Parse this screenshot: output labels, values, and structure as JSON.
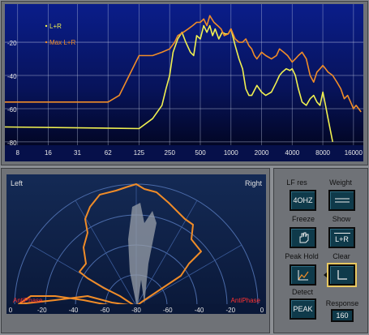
{
  "spectrum": {
    "y_ticks": [
      "-20",
      "-40",
      "-60",
      "-80"
    ],
    "x_ticks": [
      "8",
      "16",
      "31",
      "62",
      "125",
      "250",
      "500",
      "1000",
      "2000",
      "4000",
      "8000",
      "16000"
    ],
    "legend": [
      {
        "label": "L+R",
        "color": "#f0f050"
      },
      {
        "label": "Max L+R",
        "color": "#f08c28"
      }
    ],
    "chart_data": {
      "type": "line",
      "xlim": [
        6,
        20000
      ],
      "ylim": [
        -82,
        3
      ],
      "y_scale_top": 0,
      "series": [
        {
          "name": "L+R",
          "color": "#f0f050",
          "x": [
            6,
            125,
            170,
            210,
            230,
            250,
            270,
            300,
            330,
            360,
            400,
            430,
            460,
            500,
            540,
            580,
            620,
            660,
            700,
            760,
            820,
            880,
            940,
            1000,
            1100,
            1200,
            1300,
            1400,
            1500,
            1600,
            1800,
            2000,
            2200,
            2500,
            2800,
            3000,
            3200,
            3500,
            3800,
            4000,
            4300,
            4600,
            5000,
            5500,
            6000,
            6500,
            7000,
            7500,
            8000,
            8500,
            9000,
            10000
          ],
          "y": [
            -71,
            -72,
            -66,
            -58,
            -48,
            -40,
            -26,
            -18,
            -14,
            -20,
            -26,
            -28,
            -16,
            -18,
            -10,
            -14,
            -10,
            -16,
            -12,
            -18,
            -14,
            -15,
            -15,
            -12,
            -22,
            -30,
            -36,
            -48,
            -52,
            -52,
            -46,
            -50,
            -52,
            -50,
            -44,
            -40,
            -38,
            -36,
            -37,
            -36,
            -40,
            -48,
            -56,
            -58,
            -54,
            -52,
            -56,
            -58,
            -50,
            -58,
            -66,
            -80
          ]
        },
        {
          "name": "Max L+R",
          "color": "#f08c28",
          "x": [
            6,
            62,
            80,
            100,
            125,
            170,
            210,
            250,
            280,
            300,
            340,
            380,
            420,
            460,
            500,
            540,
            580,
            620,
            680,
            740,
            800,
            860,
            940,
            1000,
            1100,
            1200,
            1300,
            1400,
            1500,
            1600,
            1700,
            1800,
            2000,
            2200,
            2500,
            2800,
            3000,
            3300,
            3600,
            4000,
            4300,
            4600,
            5000,
            5500,
            6000,
            6500,
            7000,
            7500,
            8000,
            8500,
            9000,
            10000,
            11000,
            12000,
            13000,
            14000,
            15000,
            16000,
            17000,
            18000,
            19000
          ],
          "y": [
            -56,
            -56,
            -52,
            -40,
            -28,
            -28,
            -26,
            -24,
            -20,
            -16,
            -14,
            -12,
            -10,
            -8,
            -8,
            -6,
            -10,
            -4,
            -8,
            -10,
            -12,
            -16,
            -15,
            -12,
            -18,
            -20,
            -20,
            -18,
            -22,
            -24,
            -28,
            -30,
            -26,
            -28,
            -30,
            -28,
            -24,
            -26,
            -28,
            -32,
            -30,
            -28,
            -26,
            -30,
            -40,
            -44,
            -38,
            -36,
            -34,
            -36,
            -38,
            -40,
            -44,
            -48,
            -54,
            -52,
            -56,
            -60,
            -58,
            -60,
            -62
          ]
        }
      ]
    }
  },
  "phase": {
    "left_label": "Left",
    "right_label": "Right",
    "anti_left": "AntiPhase",
    "anti_right": "AntiPhase",
    "scale_labels": [
      "0",
      "-20",
      "-40",
      "-60",
      "-80",
      "-60",
      "-40",
      "-20",
      "0"
    ]
  },
  "controls": {
    "lf_res": {
      "label": "LF res",
      "button": "4OHZ"
    },
    "weight": {
      "label": "Weight",
      "button": ""
    },
    "freeze": {
      "label": "Freeze",
      "icon": "hand-icon"
    },
    "show": {
      "label": "Show",
      "button": "L+R"
    },
    "peak_hold": {
      "label": "Peak Hold",
      "icon": "peak-hold-icon"
    },
    "clear": {
      "label": "Clear",
      "icon": "clear-icon"
    },
    "detect": {
      "label": "Detect",
      "button": "PEAK"
    },
    "response": {
      "label": "Response",
      "value": "160"
    }
  }
}
